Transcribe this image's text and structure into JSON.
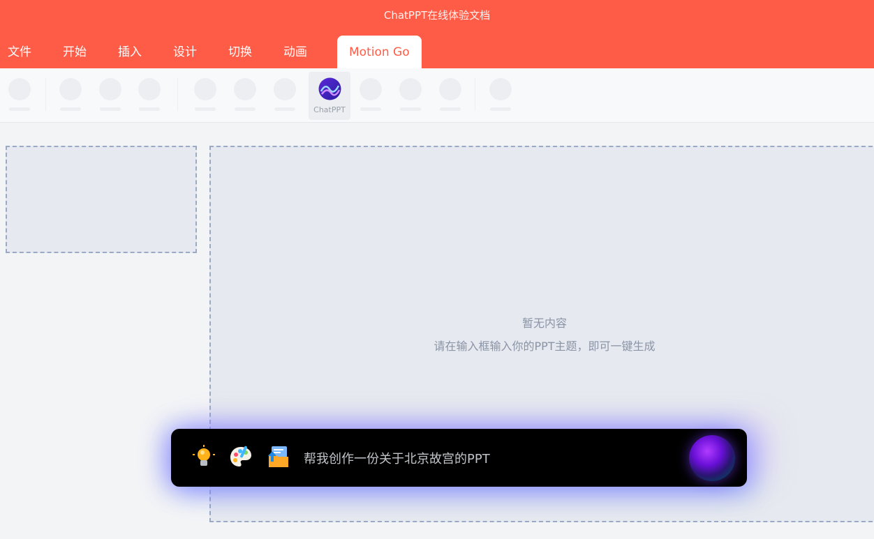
{
  "app": {
    "title": "ChatPPT在线体验文档"
  },
  "tabs": [
    {
      "label": "文件"
    },
    {
      "label": "开始"
    },
    {
      "label": "插入"
    },
    {
      "label": "设计"
    },
    {
      "label": "切换"
    },
    {
      "label": "动画"
    },
    {
      "label": "Motion Go",
      "active": true
    }
  ],
  "toolbar": {
    "chatppt_label": "ChatPPT"
  },
  "canvas": {
    "empty_title": "暂无内容",
    "empty_hint": "请在输入框输入你的PPT主题，即可一键生成"
  },
  "prompt": {
    "text": "帮我创作一份关于北京故宫的PPT",
    "icons": [
      "lightbulb-icon",
      "palette-icon",
      "folder-upload-icon",
      "ai-orb-icon"
    ]
  },
  "colors": {
    "brand": "#ff5c47",
    "prompt_bg": "#000000"
  }
}
